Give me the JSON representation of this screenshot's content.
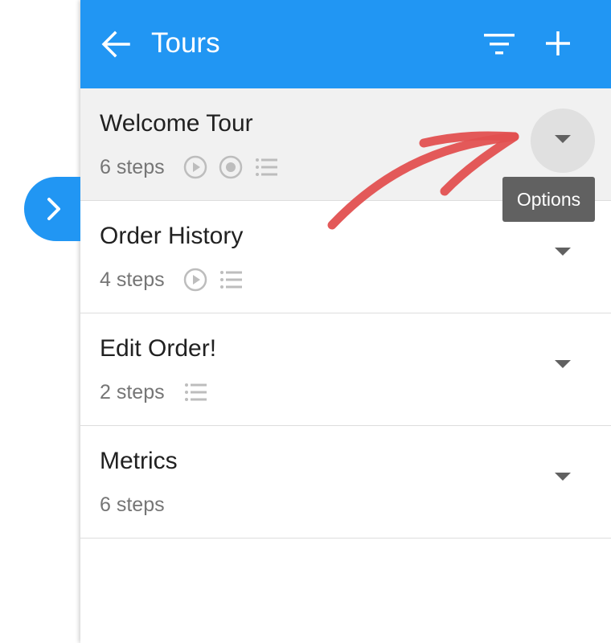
{
  "header": {
    "title": "Tours",
    "back_icon": "arrow-left-icon",
    "filter_icon": "filter-icon",
    "add_icon": "plus-icon"
  },
  "tours": [
    {
      "name": "Welcome Tour",
      "steps": "6 steps",
      "icons": [
        "play-circle-icon",
        "record-icon",
        "list-icon"
      ]
    },
    {
      "name": "Order History",
      "steps": "4 steps",
      "icons": [
        "play-circle-icon",
        "list-icon"
      ]
    },
    {
      "name": "Edit Order!",
      "steps": "2 steps",
      "icons": [
        "list-icon"
      ]
    },
    {
      "name": "Metrics",
      "steps": "6 steps",
      "icons": []
    }
  ],
  "tooltip": {
    "text": "Options"
  },
  "side_tab": {
    "icon": "chevron-right-icon"
  },
  "colors": {
    "header": "#2196F3",
    "annotation_arrow": "#E25050",
    "tooltip": "#616161",
    "row_highlight": "#F1F1F1"
  }
}
